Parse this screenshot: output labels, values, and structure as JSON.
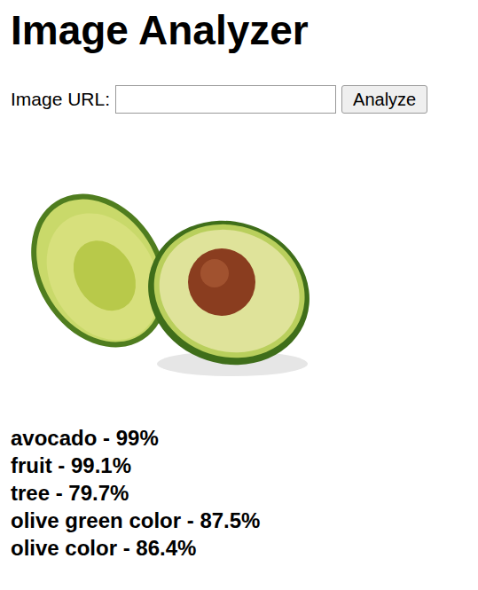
{
  "page": {
    "title": "Image Analyzer"
  },
  "url_field": {
    "label": "Image URL:",
    "value": ""
  },
  "analyze_button": {
    "label": "Analyze"
  },
  "results": [
    "avocado - 99%",
    "fruit - 99.1%",
    "tree - 79.7%",
    "olive green color - 87.5%",
    "olive color - 86.4%"
  ]
}
